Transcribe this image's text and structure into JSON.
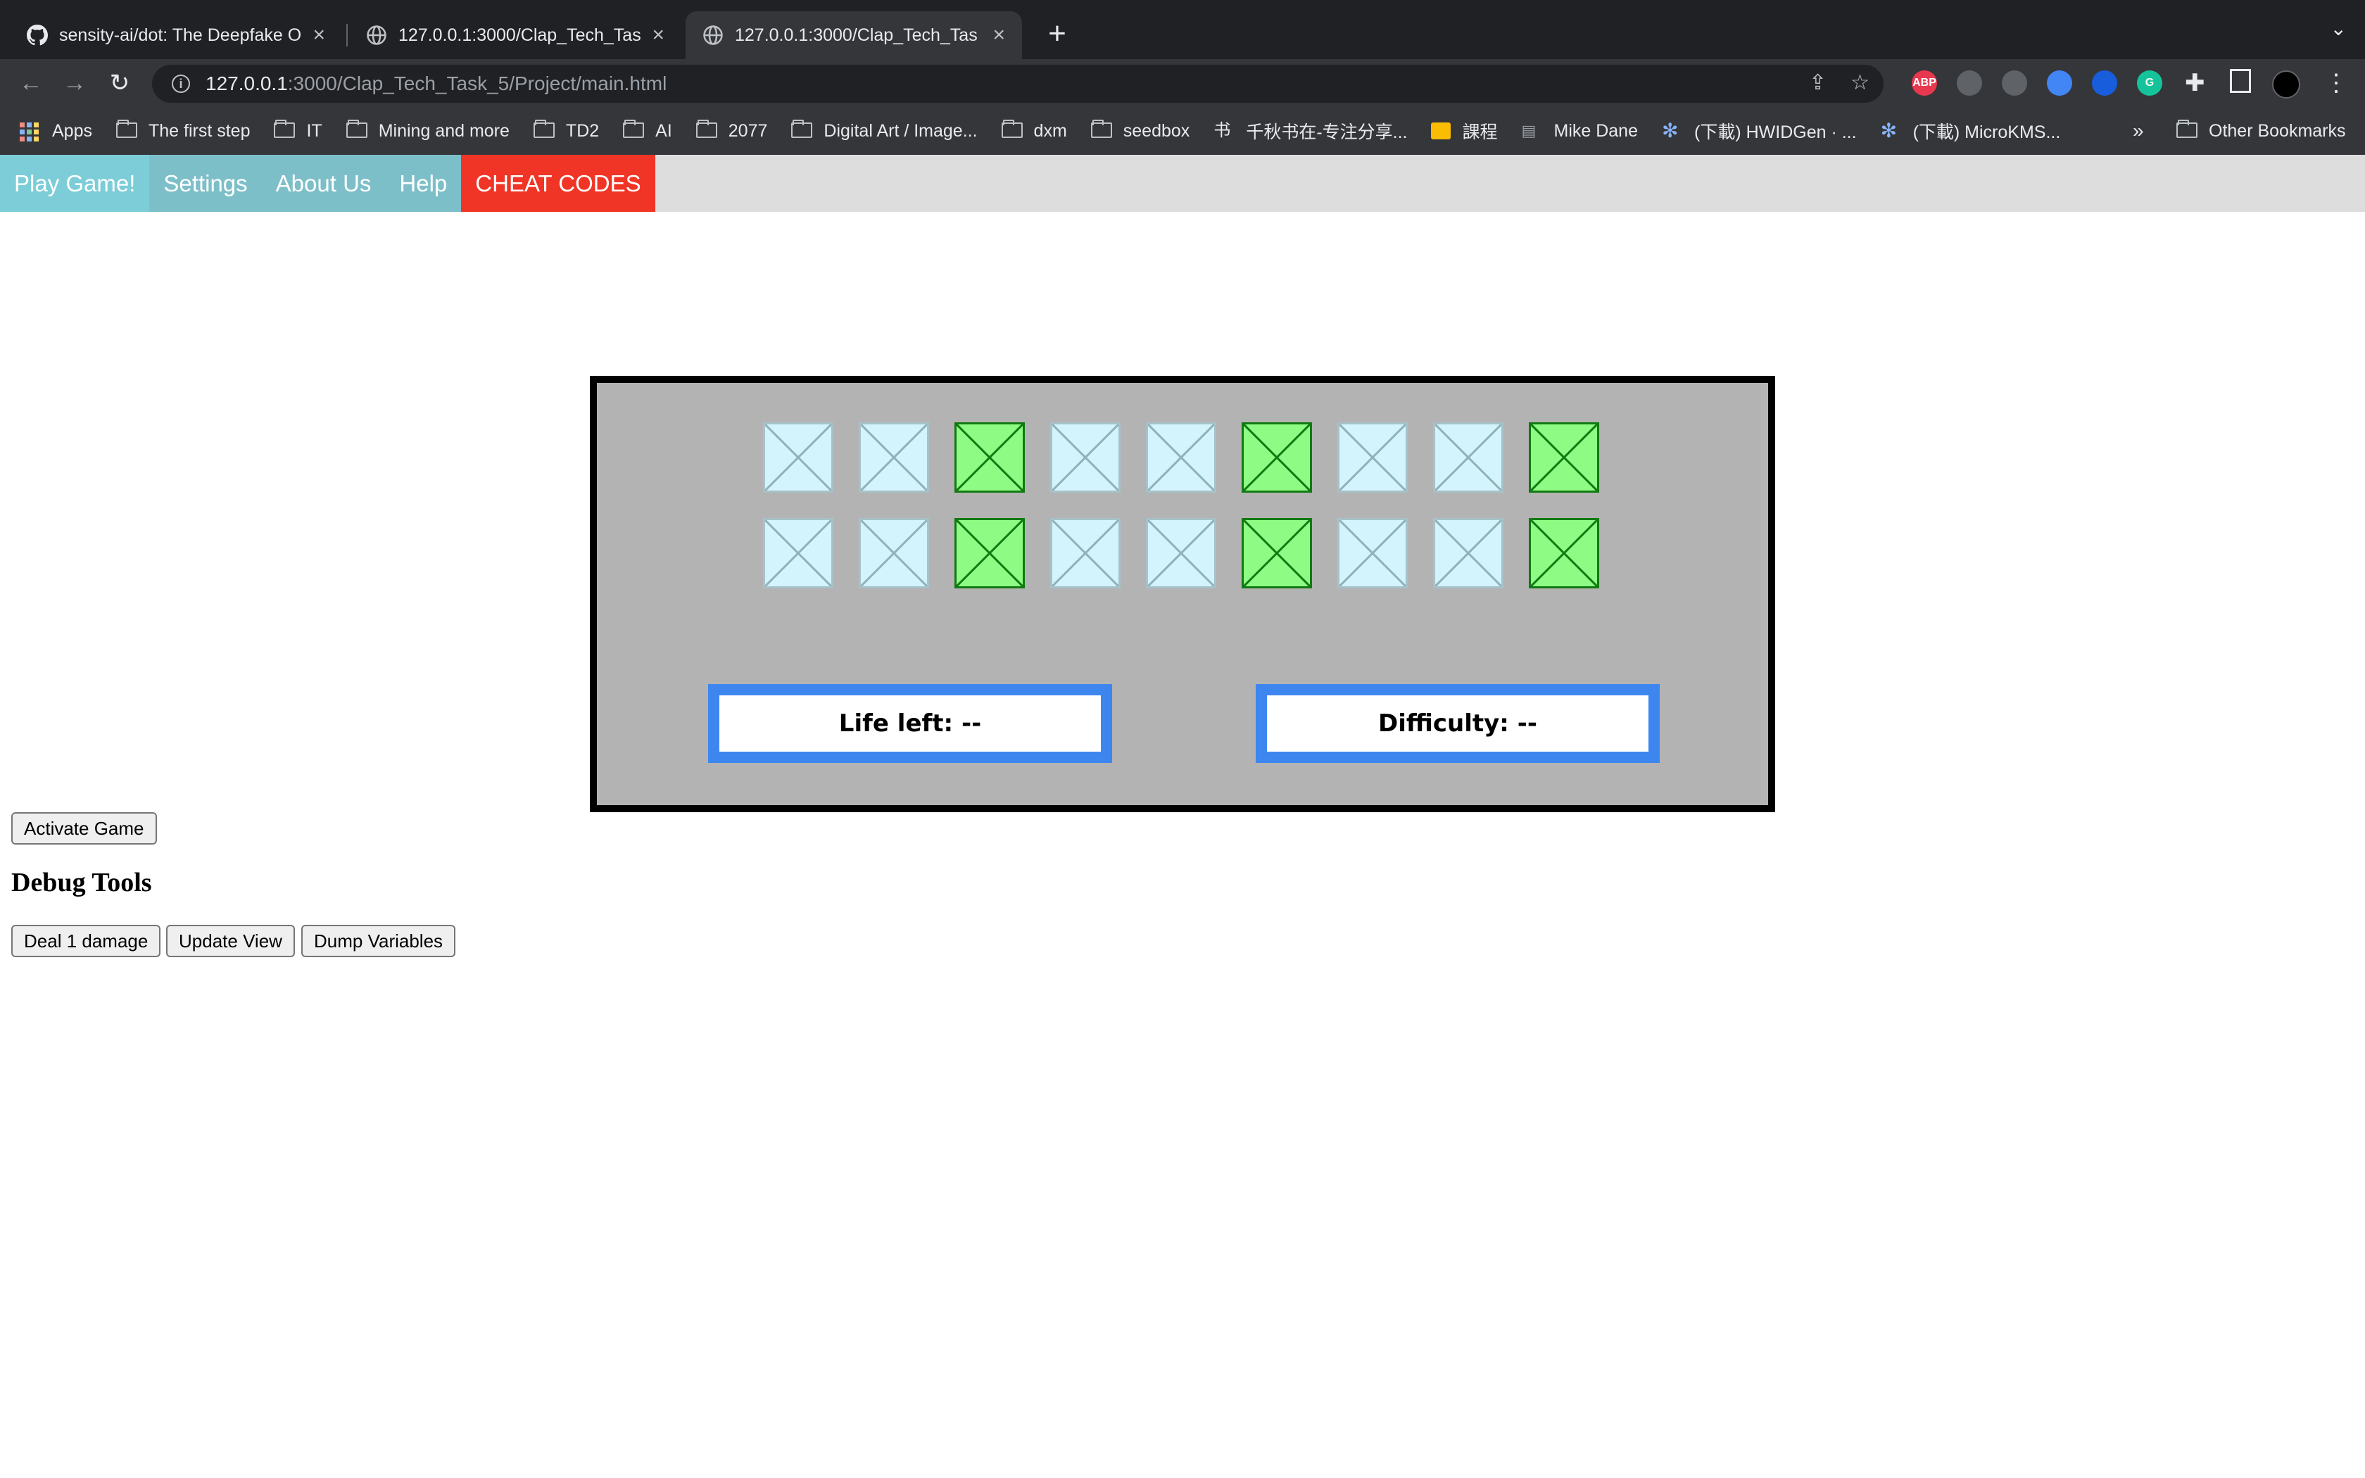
{
  "browser": {
    "tabs": [
      {
        "title": "sensity-ai/dot: The Deepfake O",
        "icon": "github-icon",
        "active": false
      },
      {
        "title": "127.0.0.1:3000/Clap_Tech_Tas",
        "icon": "globe-icon",
        "active": false
      },
      {
        "title": "127.0.0.1:3000/Clap_Tech_Tas",
        "icon": "globe-icon",
        "active": true
      }
    ],
    "url_host": "127.0.0.1",
    "url_path": ":3000/Clap_Tech_Task_5/Project/main.html",
    "extensions": [
      {
        "name": "abp-icon",
        "label": "ABP",
        "color": "#e8384f"
      },
      {
        "name": "printer-icon",
        "label": "",
        "color": "#5f6368"
      },
      {
        "name": "vpn-icon",
        "label": "",
        "color": "#5f6368"
      },
      {
        "name": "swirl-icon",
        "label": "",
        "color": "#4285f4"
      },
      {
        "name": "shield-icon",
        "label": "",
        "color": "#175ddc"
      },
      {
        "name": "grammarly-icon",
        "label": "G",
        "color": "#15c39a"
      }
    ],
    "bookmarks": [
      {
        "label": "Apps",
        "icon": "apps-icon"
      },
      {
        "label": "The first step",
        "icon": "folder-icon"
      },
      {
        "label": "IT",
        "icon": "folder-icon"
      },
      {
        "label": "Mining and more",
        "icon": "folder-icon"
      },
      {
        "label": "TD2",
        "icon": "folder-icon"
      },
      {
        "label": "AI",
        "icon": "folder-icon"
      },
      {
        "label": "2077",
        "icon": "folder-icon"
      },
      {
        "label": "Digital Art / Image...",
        "icon": "folder-icon"
      },
      {
        "label": "dxm",
        "icon": "folder-icon"
      },
      {
        "label": "seedbox",
        "icon": "folder-icon"
      },
      {
        "label": "千秋书在-专注分享...",
        "icon": "book-icon"
      },
      {
        "label": "課程",
        "icon": "classroom-icon"
      },
      {
        "label": "Mike Dane",
        "icon": "site-icon"
      },
      {
        "label": "(下載) HWIDGen · ...",
        "icon": "gear-icon"
      },
      {
        "label": "(下載) MicroKMS...",
        "icon": "gear-icon"
      }
    ],
    "bookmarks_more": "»",
    "other_bookmarks": "Other Bookmarks"
  },
  "nav": {
    "items": [
      {
        "label": "Play Game!",
        "name": "nav-play-game"
      },
      {
        "label": "Settings",
        "name": "nav-settings"
      },
      {
        "label": "About Us",
        "name": "nav-about-us"
      },
      {
        "label": "Help",
        "name": "nav-help"
      },
      {
        "label": "CHEAT CODES",
        "name": "nav-cheat-codes"
      }
    ],
    "colors": {
      "bar": "#dddddd",
      "item": "#7dbfc8",
      "first_item": "#7ccdd7",
      "cheat": "#f03425"
    }
  },
  "game": {
    "tile_rows": [
      [
        "blue",
        "blue",
        "green",
        "blue",
        "blue",
        "green",
        "blue",
        "blue",
        "green"
      ],
      [
        "blue",
        "blue",
        "green",
        "blue",
        "blue",
        "green",
        "blue",
        "blue",
        "green"
      ]
    ],
    "life_text": "Life left: --",
    "difficulty_text": "Difficulty: --",
    "colors": {
      "board": "#b3b3b3",
      "box_border": "#3d86ef",
      "tile_blue": "#d3f4fc",
      "tile_green": "#8efc84"
    }
  },
  "controls": {
    "activate_label": "Activate Game",
    "debug_heading": "Debug Tools",
    "deal_damage_label": "Deal 1 damage",
    "update_view_label": "Update View",
    "dump_variables_label": "Dump Variables"
  }
}
